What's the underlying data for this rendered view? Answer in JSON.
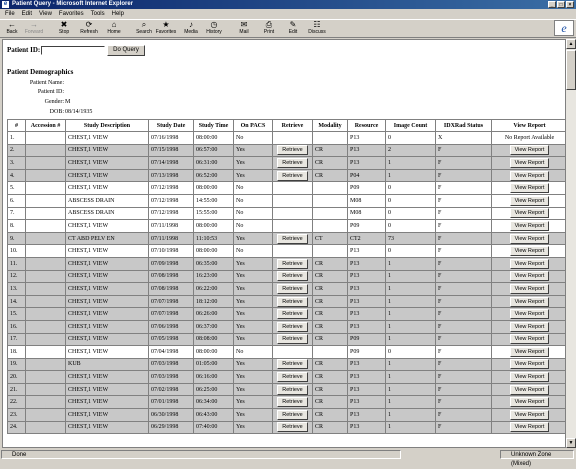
{
  "window": {
    "title": "Patient Query - Microsoft Internet Explorer"
  },
  "menu": [
    "File",
    "Edit",
    "View",
    "Favorites",
    "Tools",
    "Help"
  ],
  "toolbar": [
    {
      "label": "Back",
      "icon": "back-arrow-icon",
      "glyph": "←"
    },
    {
      "label": "Forward",
      "icon": "forward-arrow-icon",
      "glyph": "→"
    },
    {
      "label": "Stop",
      "icon": "stop-icon",
      "glyph": "✖"
    },
    {
      "label": "Refresh",
      "icon": "refresh-icon",
      "glyph": "⟳"
    },
    {
      "label": "Home",
      "icon": "home-icon",
      "glyph": "⌂"
    },
    {
      "label": "Search",
      "icon": "search-icon",
      "glyph": "⌕"
    },
    {
      "label": "Favorites",
      "icon": "favorites-icon",
      "glyph": "★"
    },
    {
      "label": "Media",
      "icon": "media-icon",
      "glyph": "♪"
    },
    {
      "label": "History",
      "icon": "history-icon",
      "glyph": "◷"
    },
    {
      "label": "Mail",
      "icon": "mail-icon",
      "glyph": "✉"
    },
    {
      "label": "Print",
      "icon": "print-icon",
      "glyph": "⎙"
    },
    {
      "label": "Edit",
      "icon": "edit-icon",
      "glyph": "✎"
    },
    {
      "label": "Discuss",
      "icon": "discuss-icon",
      "glyph": "☷"
    }
  ],
  "query": {
    "label": "Patient ID:",
    "value": "",
    "button": "Do Query"
  },
  "demographics": {
    "heading": "Patient Demographics",
    "fields": [
      {
        "label": "Patient Name:",
        "value": ""
      },
      {
        "label": "Patient ID:",
        "value": ""
      },
      {
        "label": "Gender:",
        "value": "M"
      },
      {
        "label": "DOB:",
        "value": "08/14/1935"
      }
    ]
  },
  "table": {
    "headers": [
      "#",
      "Accession #",
      "Study Description",
      "Study Date",
      "Study Time",
      "On PACS",
      "Retrieve",
      "Modality",
      "Resource",
      "Image Count",
      "IDXRad Status",
      "View Report"
    ],
    "retrieve_label": "Retrieve",
    "view_label": "View Report",
    "rows": [
      {
        "n": "1.",
        "acc": "",
        "desc": "CHEST,1 VIEW",
        "date": "07/16/1998",
        "time": "08:00:00",
        "pacs": "No",
        "retrieve": false,
        "mod": "",
        "res": "P13",
        "count": "0",
        "status": "X",
        "view": "No Report Available",
        "g": false
      },
      {
        "n": "2.",
        "acc": "",
        "desc": "CHEST,1 VIEW",
        "date": "07/15/1998",
        "time": "06:57:00",
        "pacs": "Yes",
        "retrieve": true,
        "mod": "CR",
        "res": "P13",
        "count": "2",
        "status": "F",
        "view": "btn",
        "g": true
      },
      {
        "n": "3.",
        "acc": "",
        "desc": "CHEST,1 VIEW",
        "date": "07/14/1998",
        "time": "06:31:00",
        "pacs": "Yes",
        "retrieve": true,
        "mod": "CR",
        "res": "P13",
        "count": "1",
        "status": "F",
        "view": "btn",
        "g": true
      },
      {
        "n": "4.",
        "acc": "",
        "desc": "CHEST,1 VIEW",
        "date": "07/13/1998",
        "time": "06:52:00",
        "pacs": "Yes",
        "retrieve": true,
        "mod": "CR",
        "res": "P04",
        "count": "1",
        "status": "F",
        "view": "btn",
        "g": true
      },
      {
        "n": "5.",
        "acc": "",
        "desc": "CHEST,1 VIEW",
        "date": "07/12/1998",
        "time": "08:00:00",
        "pacs": "No",
        "retrieve": false,
        "mod": "",
        "res": "P09",
        "count": "0",
        "status": "F",
        "view": "btn",
        "g": false
      },
      {
        "n": "6.",
        "acc": "",
        "desc": "ABSCESS DRAIN",
        "date": "07/12/1998",
        "time": "14:55:00",
        "pacs": "No",
        "retrieve": false,
        "mod": "",
        "res": "M08",
        "count": "0",
        "status": "F",
        "view": "btn",
        "g": false
      },
      {
        "n": "7.",
        "acc": "",
        "desc": "ABSCESS DRAIN",
        "date": "07/12/1998",
        "time": "15:55:00",
        "pacs": "No",
        "retrieve": false,
        "mod": "",
        "res": "M08",
        "count": "0",
        "status": "F",
        "view": "btn",
        "g": false
      },
      {
        "n": "8.",
        "acc": "",
        "desc": "CHEST,1 VIEW",
        "date": "07/11/1998",
        "time": "08:00:00",
        "pacs": "No",
        "retrieve": false,
        "mod": "",
        "res": "P09",
        "count": "0",
        "status": "F",
        "view": "btn",
        "g": false
      },
      {
        "n": "9.",
        "acc": "",
        "desc": "CT ABD PELV EN",
        "date": "07/11/1998",
        "time": "11:10:53",
        "pacs": "Yes",
        "retrieve": true,
        "mod": "CT",
        "res": "CT2",
        "count": "73",
        "status": "F",
        "view": "btn",
        "g": true
      },
      {
        "n": "10.",
        "acc": "",
        "desc": "CHEST,1 VIEW",
        "date": "07/10/1998",
        "time": "08:00:00",
        "pacs": "No",
        "retrieve": false,
        "mod": "",
        "res": "P13",
        "count": "0",
        "status": "F",
        "view": "btn",
        "g": false
      },
      {
        "n": "11.",
        "acc": "",
        "desc": "CHEST,1 VIEW",
        "date": "07/09/1998",
        "time": "06:35:00",
        "pacs": "Yes",
        "retrieve": true,
        "mod": "CR",
        "res": "P13",
        "count": "1",
        "status": "F",
        "view": "btn",
        "g": true
      },
      {
        "n": "12.",
        "acc": "",
        "desc": "CHEST,1 VIEW",
        "date": "07/08/1998",
        "time": "16:23:00",
        "pacs": "Yes",
        "retrieve": true,
        "mod": "CR",
        "res": "P13",
        "count": "1",
        "status": "F",
        "view": "btn",
        "g": true
      },
      {
        "n": "13.",
        "acc": "",
        "desc": "CHEST,1 VIEW",
        "date": "07/08/1998",
        "time": "06:22:00",
        "pacs": "Yes",
        "retrieve": true,
        "mod": "CR",
        "res": "P13",
        "count": "1",
        "status": "F",
        "view": "btn",
        "g": true
      },
      {
        "n": "14.",
        "acc": "",
        "desc": "CHEST,1 VIEW",
        "date": "07/07/1998",
        "time": "18:12:00",
        "pacs": "Yes",
        "retrieve": true,
        "mod": "CR",
        "res": "P13",
        "count": "1",
        "status": "F",
        "view": "btn",
        "g": true
      },
      {
        "n": "15.",
        "acc": "",
        "desc": "CHEST,1 VIEW",
        "date": "07/07/1998",
        "time": "06:26:00",
        "pacs": "Yes",
        "retrieve": true,
        "mod": "CR",
        "res": "P13",
        "count": "1",
        "status": "F",
        "view": "btn",
        "g": true
      },
      {
        "n": "16.",
        "acc": "",
        "desc": "CHEST,1 VIEW",
        "date": "07/06/1998",
        "time": "06:37:00",
        "pacs": "Yes",
        "retrieve": true,
        "mod": "CR",
        "res": "P13",
        "count": "1",
        "status": "F",
        "view": "btn",
        "g": true
      },
      {
        "n": "17.",
        "acc": "",
        "desc": "CHEST,1 VIEW",
        "date": "07/05/1998",
        "time": "08:08:00",
        "pacs": "Yes",
        "retrieve": true,
        "mod": "CR",
        "res": "P09",
        "count": "1",
        "status": "F",
        "view": "btn",
        "g": true
      },
      {
        "n": "18.",
        "acc": "",
        "desc": "CHEST,1 VIEW",
        "date": "07/04/1998",
        "time": "08:00:00",
        "pacs": "No",
        "retrieve": false,
        "mod": "",
        "res": "P09",
        "count": "0",
        "status": "F",
        "view": "btn",
        "g": false
      },
      {
        "n": "19.",
        "acc": "",
        "desc": "KUB",
        "date": "07/03/1998",
        "time": "01:05:00",
        "pacs": "Yes",
        "retrieve": true,
        "mod": "CR",
        "res": "P13",
        "count": "1",
        "status": "F",
        "view": "btn",
        "g": true
      },
      {
        "n": "20.",
        "acc": "",
        "desc": "CHEST,1 VIEW",
        "date": "07/03/1998",
        "time": "06:16:00",
        "pacs": "Yes",
        "retrieve": true,
        "mod": "CR",
        "res": "P13",
        "count": "1",
        "status": "F",
        "view": "btn",
        "g": true
      },
      {
        "n": "21.",
        "acc": "",
        "desc": "CHEST,1 VIEW",
        "date": "07/02/1998",
        "time": "06:25:00",
        "pacs": "Yes",
        "retrieve": true,
        "mod": "CR",
        "res": "P13",
        "count": "1",
        "status": "F",
        "view": "btn",
        "g": true
      },
      {
        "n": "22.",
        "acc": "",
        "desc": "CHEST,1 VIEW",
        "date": "07/01/1998",
        "time": "06:34:00",
        "pacs": "Yes",
        "retrieve": true,
        "mod": "CR",
        "res": "P13",
        "count": "1",
        "status": "F",
        "view": "btn",
        "g": true
      },
      {
        "n": "23.",
        "acc": "",
        "desc": "CHEST,1 VIEW",
        "date": "06/30/1998",
        "time": "06:43:00",
        "pacs": "Yes",
        "retrieve": true,
        "mod": "CR",
        "res": "P13",
        "count": "1",
        "status": "F",
        "view": "btn",
        "g": true
      },
      {
        "n": "24.",
        "acc": "",
        "desc": "CHEST,1 VIEW",
        "date": "06/29/1998",
        "time": "07:40:00",
        "pacs": "Yes",
        "retrieve": true,
        "mod": "CR",
        "res": "P13",
        "count": "1",
        "status": "F",
        "view": "btn",
        "g": true
      }
    ]
  },
  "status": {
    "left": "Done",
    "zone": "Unknown Zone (Mixed)"
  }
}
